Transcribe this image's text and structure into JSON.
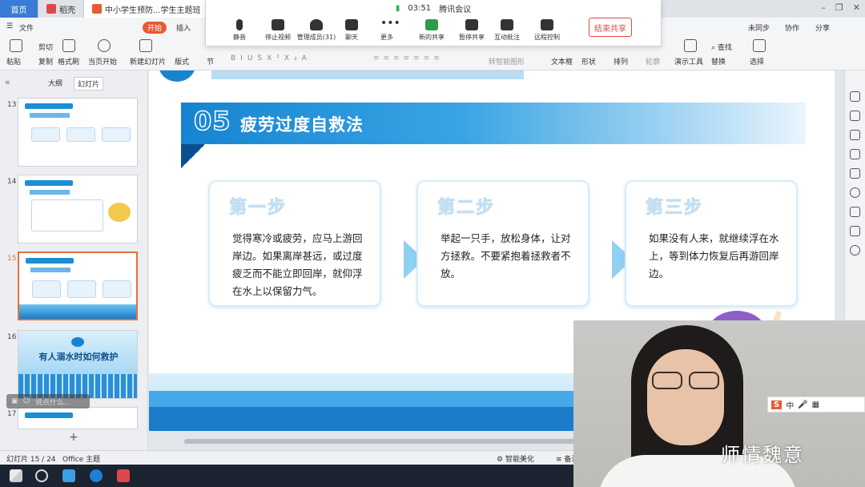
{
  "tabs": {
    "home": "首页",
    "app": "稻壳",
    "doc": "中小学生预防...学生主题班"
  },
  "menu": {
    "file": "文件",
    "start": "开始",
    "insert": "插入"
  },
  "ribbon": {
    "paste": "粘贴",
    "cut": "剪切",
    "copy": "复制",
    "format_painter": "格式刷",
    "play_from_current": "当页开始",
    "new_slide": "新建幻灯片",
    "layout": "版式",
    "section": "节",
    "text_box": "文本框",
    "shape": "形状",
    "arrange": "排列",
    "outline": "轮廓",
    "presenter_tools": "演示工具",
    "find": "查找",
    "replace": "替换",
    "select": "选择",
    "smart_shape": "转智能图形",
    "unsynced": "未同步",
    "collab": "协作",
    "share": "分享"
  },
  "meeting": {
    "time": "03:51",
    "app": "腾讯会议",
    "buttons": [
      "静音",
      "停止视频",
      "管理成员(31)",
      "聊天",
      "更多",
      "新的共享",
      "暂停共享",
      "互动批注",
      "远程控制"
    ],
    "end_share": "结束共享"
  },
  "sidebar": {
    "tab_outline": "大纲",
    "tab_slides": "幻灯片",
    "slides": [
      {
        "num": "13"
      },
      {
        "num": "14"
      },
      {
        "num": "15",
        "selected": true
      },
      {
        "num": "16",
        "title": "有人溺水时如何救护"
      },
      {
        "num": "17"
      }
    ],
    "comment_placeholder": "说点什么..."
  },
  "slide": {
    "number": "05",
    "title": "疲劳过度自救法",
    "cards": [
      {
        "step": "第一步",
        "text": "觉得寒冷或疲劳，应马上游回岸边。如果离岸甚远，或过度疲乏而不能立即回岸，就仰浮在水上以保留力气。"
      },
      {
        "step": "第二步",
        "text": "举起一只手，放松身体，让对方拯救。不要紧抱着拯救者不放。"
      },
      {
        "step": "第三步",
        "text": "如果没有人来，就继续浮在水上，等到体力恢复后再游回岸边。"
      }
    ]
  },
  "status": {
    "slide_counter": "幻灯片 15 / 24",
    "theme": "Office 主题",
    "beautify": "智能美化",
    "notes": "备注"
  },
  "ime": {
    "label": "中"
  },
  "watermark": "师情魏意",
  "colors": {
    "accent": "#1784d1",
    "brand_red": "#e0474c",
    "start_orange": "#e85a2f"
  }
}
